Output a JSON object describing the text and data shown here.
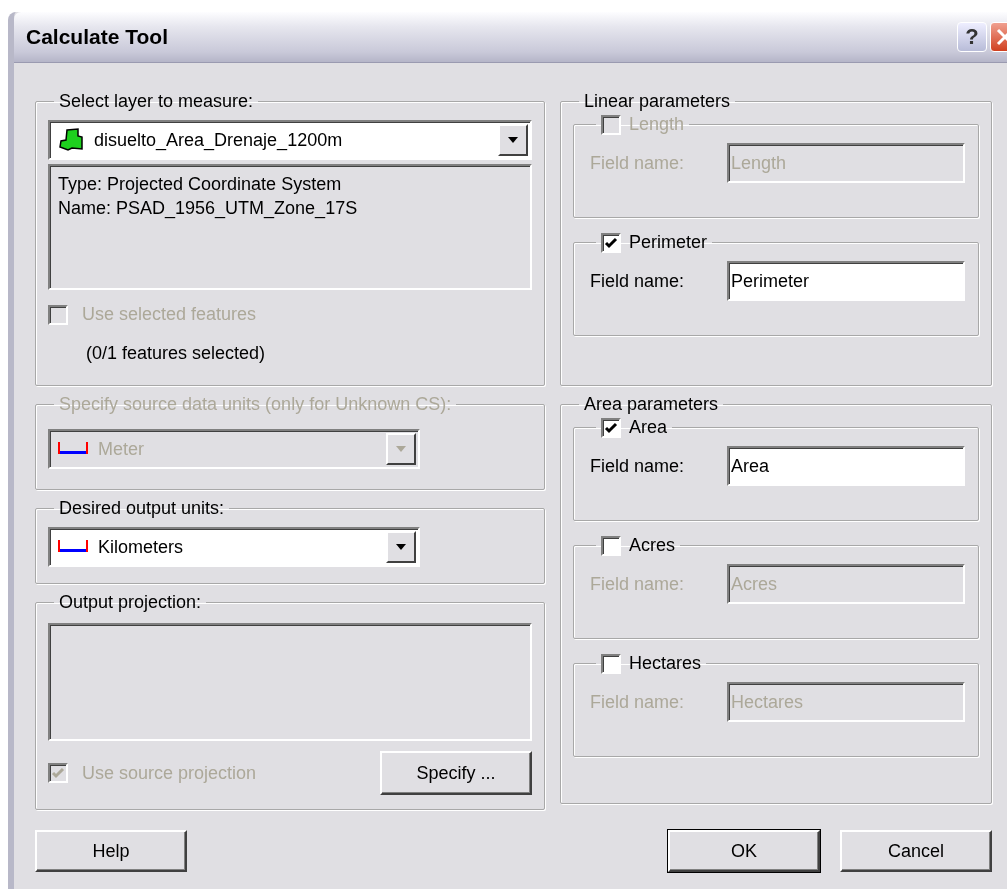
{
  "window": {
    "title": "Calculate Tool",
    "help_button": "?"
  },
  "layer_group": {
    "label": "Select layer to measure:",
    "layer": "disuelto_Area_Drenaje_1200m",
    "info": [
      "Type: Projected Coordinate System",
      "Name: PSAD_1956_UTM_Zone_17S"
    ],
    "use_selected": {
      "label": "Use selected features",
      "checked": false,
      "disabled": true
    },
    "selection_count": "(0/1 features selected)"
  },
  "source_units": {
    "label": "Specify source data units (only for Unknown CS):",
    "value": "Meter",
    "disabled": true
  },
  "output_units": {
    "label": "Desired output units:",
    "value": "Kilometers",
    "disabled": false
  },
  "output_projection": {
    "label": "Output projection:",
    "use_source": {
      "label": "Use source projection",
      "checked": true,
      "disabled": true
    },
    "specify_button": "Specify ..."
  },
  "linear_parameters": {
    "label": "Linear parameters",
    "items": [
      {
        "label": "Length",
        "checked": false,
        "disabled": true,
        "field_label": "Field name:",
        "field_value": "Length"
      },
      {
        "label": "Perimeter",
        "checked": true,
        "disabled": false,
        "field_label": "Field name:",
        "field_value": "Perimeter"
      }
    ]
  },
  "area_parameters": {
    "label": "Area parameters",
    "items": [
      {
        "label": "Area",
        "checked": true,
        "disabled": false,
        "field_label": "Field name:",
        "field_value": "Area"
      },
      {
        "label": "Acres",
        "checked": false,
        "disabled": false,
        "field_label": "Field name:",
        "field_value": "Acres"
      },
      {
        "label": "Hectares",
        "checked": false,
        "disabled": false,
        "field_label": "Field name:",
        "field_value": "Hectares"
      }
    ]
  },
  "buttons": [
    {
      "label": "Help",
      "default": false
    },
    {
      "label": "OK",
      "default": true
    },
    {
      "label": "Cancel",
      "default": false
    }
  ]
}
